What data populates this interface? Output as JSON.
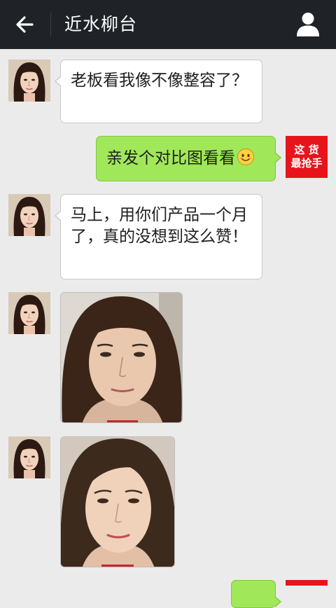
{
  "header": {
    "title": "近水柳台"
  },
  "contact": {
    "self_badge_line1": "这 货",
    "self_badge_line2": "最抢手"
  },
  "messages": [
    {
      "sender": "contact",
      "type": "text",
      "text": "老板看我像不像整容了？"
    },
    {
      "sender": "self",
      "type": "text",
      "text": "亲发个对比图看看",
      "emoji": "smile-emoji"
    },
    {
      "sender": "contact",
      "type": "text",
      "text": "马上，用你们产品一个月了，真的没想到这么赞！"
    },
    {
      "sender": "contact",
      "type": "image",
      "image": "before-face-photo"
    },
    {
      "sender": "contact",
      "type": "image",
      "image": "after-face-photo"
    },
    {
      "sender": "self",
      "type": "text",
      "text": ""
    }
  ],
  "colors": {
    "topbar": "#1f2327",
    "chat_background": "#ebebeb",
    "outgoing_bubble": "#a0e75a",
    "incoming_bubble": "#ffffff",
    "self_avatar": "#e8141b"
  }
}
